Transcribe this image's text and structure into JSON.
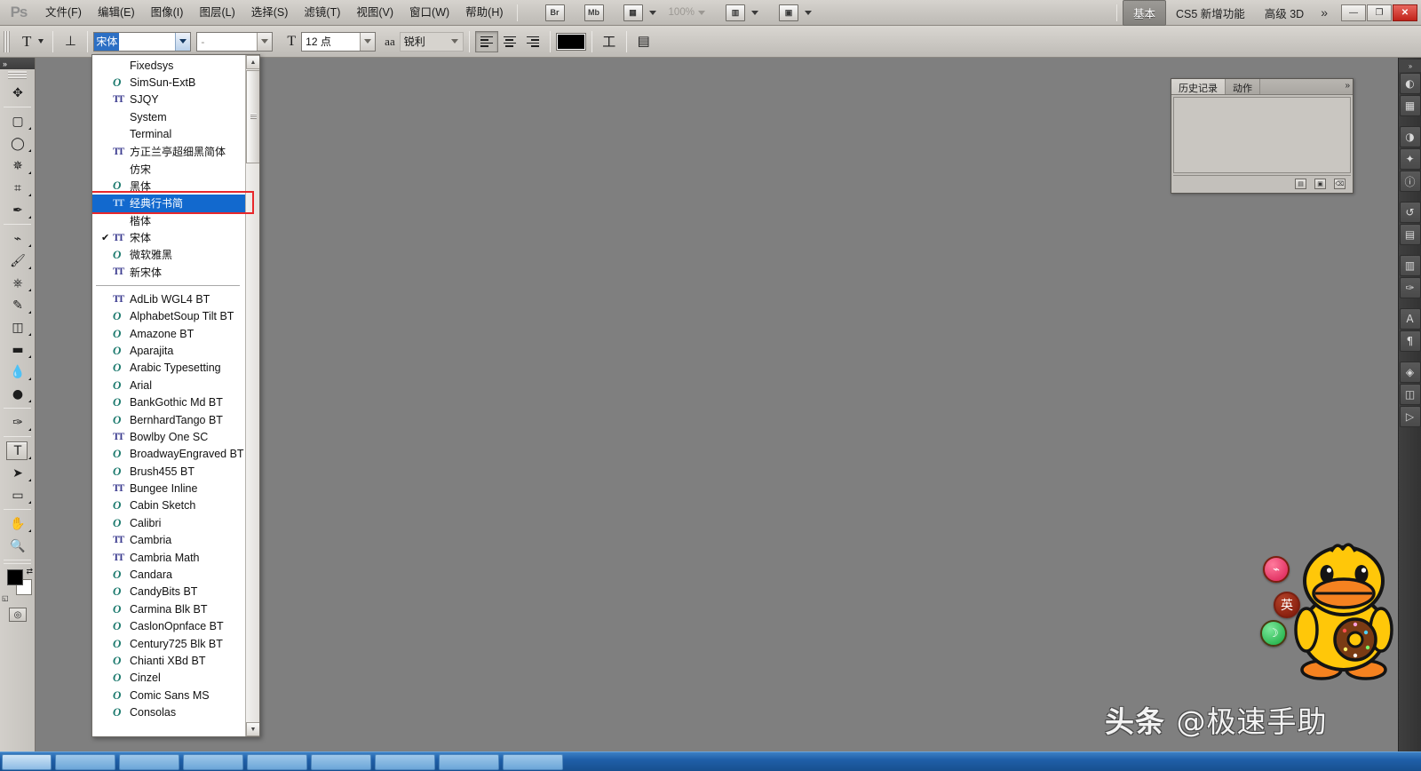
{
  "app": {
    "logo": "Ps",
    "menus": [
      {
        "label": "文件(F)"
      },
      {
        "label": "编辑(E)"
      },
      {
        "label": "图像(I)"
      },
      {
        "label": "图层(L)"
      },
      {
        "label": "选择(S)"
      },
      {
        "label": "滤镜(T)"
      },
      {
        "label": "视图(V)"
      },
      {
        "label": "窗口(W)"
      },
      {
        "label": "帮助(H)"
      }
    ],
    "bridge_label": "Br",
    "minibridge_label": "Mb",
    "zoom_level": "100%",
    "workspaces": [
      {
        "label": "基本",
        "active": true
      },
      {
        "label": "CS5 新增功能",
        "active": false
      },
      {
        "label": "高级 3D",
        "active": false
      }
    ],
    "more_chevron": "»",
    "window_controls": {
      "minimize": "—",
      "restore": "❐",
      "close": "✕"
    }
  },
  "options_bar": {
    "tool_preset_icon": "T",
    "orientation_icon": "⊥",
    "font_family": {
      "value": "宋体",
      "selected": true
    },
    "font_style": {
      "value": "-",
      "placeholder": "-"
    },
    "font_size_icon": "T",
    "font_size": {
      "value": "12 点"
    },
    "antialias_icon": "aa",
    "antialias": {
      "value": "锐利"
    },
    "align": [
      {
        "name": "align-left",
        "active": true
      },
      {
        "name": "align-center",
        "active": false
      },
      {
        "name": "align-right",
        "active": false
      }
    ],
    "text_color": "#000000",
    "warp_icon": "工",
    "panels_icon": "▤"
  },
  "toolbar": {
    "collapse_icon": "»",
    "tools": [
      {
        "name": "move-tool",
        "glyph": "✥",
        "selected": false,
        "has_submenu": false
      },
      {
        "name": "marquee-tool",
        "glyph": "▢",
        "selected": false,
        "has_submenu": true
      },
      {
        "name": "lasso-tool",
        "glyph": "◯",
        "selected": false,
        "has_submenu": true
      },
      {
        "name": "quick-selection-tool",
        "glyph": "✵",
        "selected": false,
        "has_submenu": true
      },
      {
        "name": "crop-tool",
        "glyph": "⌗",
        "selected": false,
        "has_submenu": true
      },
      {
        "name": "eyedropper-tool",
        "glyph": "✒",
        "selected": false,
        "has_submenu": true
      },
      {
        "name": "spot-healing-brush-tool",
        "glyph": "⌁",
        "selected": false,
        "has_submenu": true
      },
      {
        "name": "brush-tool",
        "glyph": "🖌",
        "selected": false,
        "has_submenu": true
      },
      {
        "name": "clone-stamp-tool",
        "glyph": "⎈",
        "selected": false,
        "has_submenu": true
      },
      {
        "name": "history-brush-tool",
        "glyph": "✎",
        "selected": false,
        "has_submenu": true
      },
      {
        "name": "eraser-tool",
        "glyph": "◫",
        "selected": false,
        "has_submenu": true
      },
      {
        "name": "gradient-tool",
        "glyph": "▬",
        "selected": false,
        "has_submenu": true
      },
      {
        "name": "blur-tool",
        "glyph": "💧",
        "selected": false,
        "has_submenu": true
      },
      {
        "name": "dodge-tool",
        "glyph": "●",
        "selected": false,
        "has_submenu": true
      },
      {
        "name": "pen-tool",
        "glyph": "✑",
        "selected": false,
        "has_submenu": true
      },
      {
        "name": "horizontal-type-tool",
        "glyph": "T",
        "selected": true,
        "has_submenu": true
      },
      {
        "name": "path-selection-tool",
        "glyph": "➤",
        "selected": false,
        "has_submenu": true
      },
      {
        "name": "rectangle-tool",
        "glyph": "▭",
        "selected": false,
        "has_submenu": true
      },
      {
        "name": "hand-tool",
        "glyph": "✋",
        "selected": false,
        "has_submenu": true
      },
      {
        "name": "zoom-tool",
        "glyph": "🔍",
        "selected": false,
        "has_submenu": false
      }
    ],
    "foreground_color": "#000000",
    "background_color": "#ffffff",
    "swap_icon": "⇄",
    "default_icon": "◱",
    "quickmask_icon": "◎"
  },
  "font_dropdown": {
    "sections": [
      {
        "items": [
          {
            "name": "Fixedsys",
            "icon": "none",
            "checked": false,
            "selected": false,
            "cjk": false
          },
          {
            "name": "SimSun-ExtB",
            "icon": "opentype",
            "checked": false,
            "selected": false,
            "cjk": false
          },
          {
            "name": "SJQY",
            "icon": "truetype",
            "checked": false,
            "selected": false,
            "cjk": false
          },
          {
            "name": "System",
            "icon": "none",
            "checked": false,
            "selected": false,
            "cjk": false
          },
          {
            "name": "Terminal",
            "icon": "none",
            "checked": false,
            "selected": false,
            "cjk": false
          },
          {
            "name": "方正兰亭超细黑简体",
            "icon": "truetype",
            "checked": false,
            "selected": false,
            "cjk": true
          },
          {
            "name": "仿宋",
            "icon": "none",
            "checked": false,
            "selected": false,
            "cjk": true
          },
          {
            "name": "黑体",
            "icon": "opentype",
            "checked": false,
            "selected": false,
            "cjk": true
          },
          {
            "name": "经典行书简",
            "icon": "truetype",
            "checked": false,
            "selected": true,
            "cjk": true
          },
          {
            "name": "楷体",
            "icon": "none",
            "checked": false,
            "selected": false,
            "cjk": true
          },
          {
            "name": "宋体",
            "icon": "truetype",
            "checked": true,
            "selected": false,
            "cjk": true
          },
          {
            "name": "微软雅黑",
            "icon": "opentype",
            "checked": false,
            "selected": false,
            "cjk": true
          },
          {
            "name": "新宋体",
            "icon": "truetype",
            "checked": false,
            "selected": false,
            "cjk": true
          }
        ]
      },
      {
        "items": [
          {
            "name": "AdLib WGL4 BT",
            "icon": "truetype",
            "checked": false,
            "selected": false,
            "cjk": false
          },
          {
            "name": "AlphabetSoup Tilt BT",
            "icon": "opentype",
            "checked": false,
            "selected": false,
            "cjk": false
          },
          {
            "name": "Amazone BT",
            "icon": "opentype",
            "checked": false,
            "selected": false,
            "cjk": false
          },
          {
            "name": "Aparajita",
            "icon": "opentype",
            "checked": false,
            "selected": false,
            "cjk": false
          },
          {
            "name": "Arabic Typesetting",
            "icon": "opentype",
            "checked": false,
            "selected": false,
            "cjk": false
          },
          {
            "name": "Arial",
            "icon": "opentype",
            "checked": false,
            "selected": false,
            "cjk": false
          },
          {
            "name": "BankGothic Md BT",
            "icon": "opentype",
            "checked": false,
            "selected": false,
            "cjk": false
          },
          {
            "name": "BernhardTango BT",
            "icon": "opentype",
            "checked": false,
            "selected": false,
            "cjk": false
          },
          {
            "name": "Bowlby One SC",
            "icon": "truetype",
            "checked": false,
            "selected": false,
            "cjk": false
          },
          {
            "name": "BroadwayEngraved BT",
            "icon": "opentype",
            "checked": false,
            "selected": false,
            "cjk": false
          },
          {
            "name": "Brush455 BT",
            "icon": "opentype",
            "checked": false,
            "selected": false,
            "cjk": false
          },
          {
            "name": "Bungee Inline",
            "icon": "truetype",
            "checked": false,
            "selected": false,
            "cjk": false
          },
          {
            "name": "Cabin Sketch",
            "icon": "opentype",
            "checked": false,
            "selected": false,
            "cjk": false
          },
          {
            "name": "Calibri",
            "icon": "opentype",
            "checked": false,
            "selected": false,
            "cjk": false
          },
          {
            "name": "Cambria",
            "icon": "truetype",
            "checked": false,
            "selected": false,
            "cjk": false
          },
          {
            "name": "Cambria Math",
            "icon": "truetype",
            "checked": false,
            "selected": false,
            "cjk": false
          },
          {
            "name": "Candara",
            "icon": "opentype",
            "checked": false,
            "selected": false,
            "cjk": false
          },
          {
            "name": "CandyBits BT",
            "icon": "opentype",
            "checked": false,
            "selected": false,
            "cjk": false
          },
          {
            "name": "Carmina Blk BT",
            "icon": "opentype",
            "checked": false,
            "selected": false,
            "cjk": false
          },
          {
            "name": "CaslonOpnface BT",
            "icon": "opentype",
            "checked": false,
            "selected": false,
            "cjk": false
          },
          {
            "name": "Century725 Blk BT",
            "icon": "opentype",
            "checked": false,
            "selected": false,
            "cjk": false
          },
          {
            "name": "Chianti XBd BT",
            "icon": "opentype",
            "checked": false,
            "selected": false,
            "cjk": false
          },
          {
            "name": "Cinzel",
            "icon": "opentype",
            "checked": false,
            "selected": false,
            "cjk": false
          },
          {
            "name": "Comic Sans MS",
            "icon": "opentype",
            "checked": false,
            "selected": false,
            "cjk": false
          },
          {
            "name": "Consolas",
            "icon": "opentype",
            "checked": false,
            "selected": false,
            "cjk": false
          }
        ]
      }
    ],
    "scrollbar": {
      "up_arrow": "▲",
      "down_arrow": "▼"
    },
    "highlight_color": "#1269ce",
    "annotation_box_color": "#e8282b"
  },
  "history_panel": {
    "tabs": [
      {
        "label": "历史记录",
        "active": true
      },
      {
        "label": "动作",
        "active": false
      }
    ],
    "menu_icon": "»",
    "footer_icons": [
      "new-snapshot-icon",
      "new-document-icon",
      "delete-icon"
    ]
  },
  "right_dock": {
    "icons": [
      "color-panel-icon",
      "swatches-panel-icon",
      "adjustments-panel-icon",
      "styles-panel-icon",
      "info-panel-icon",
      "history-panel-icon",
      "layers-panel-icon",
      "channels-panel-icon",
      "paths-panel-icon",
      "character-panel-icon",
      "paragraph-panel-icon",
      "3d-panel-icon",
      "masks-panel-icon",
      "animation-panel-icon"
    ]
  },
  "ime_widget": {
    "buttons": [
      {
        "name": "ime-toolbox-button",
        "glyph": "⌁",
        "color": "#d81c52"
      },
      {
        "name": "ime-language-button",
        "glyph": "英",
        "color": "#7c1405"
      },
      {
        "name": "ime-status-button",
        "glyph": "☽",
        "color": "#14a83c"
      }
    ],
    "mascot": "yellow-duck-mascot"
  },
  "watermark": {
    "brand": "头条",
    "handle": "@极速手助"
  }
}
